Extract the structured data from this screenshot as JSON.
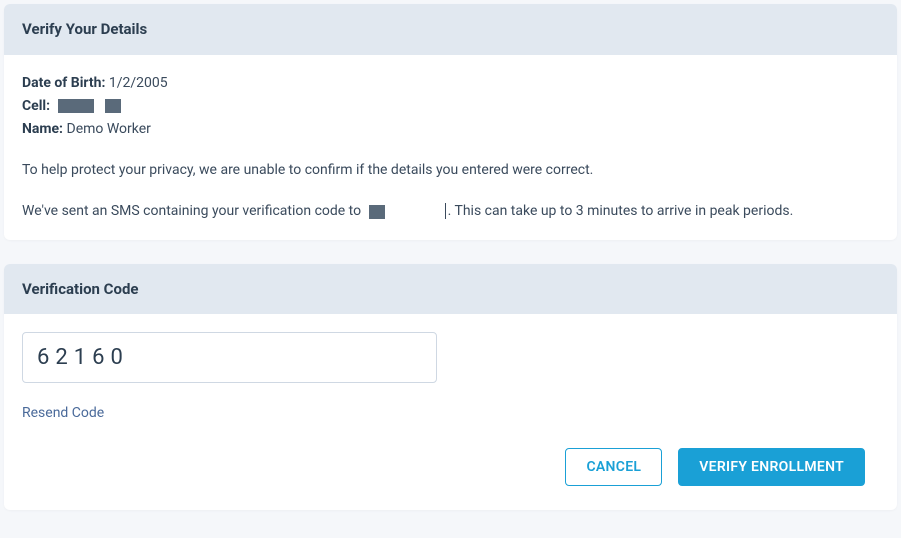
{
  "details_card": {
    "title": "Verify Your Details",
    "dob_label": "Date of Birth:",
    "dob_value": "1/2/2005",
    "cell_label": "Cell:",
    "name_label": "Name:",
    "name_value": "Demo Worker",
    "privacy_text": "To help protect your privacy, we are unable to confirm if the details you entered were correct.",
    "sms_text_prefix": "We've sent an SMS containing your verification code to ",
    "sms_text_suffix": ". This can take up to 3 minutes to arrive in peak periods."
  },
  "code_card": {
    "title": "Verification Code",
    "code_value": "62160",
    "resend_label": "Resend Code",
    "cancel_label": "CANCEL",
    "verify_label": "VERIFY ENROLLMENT"
  }
}
